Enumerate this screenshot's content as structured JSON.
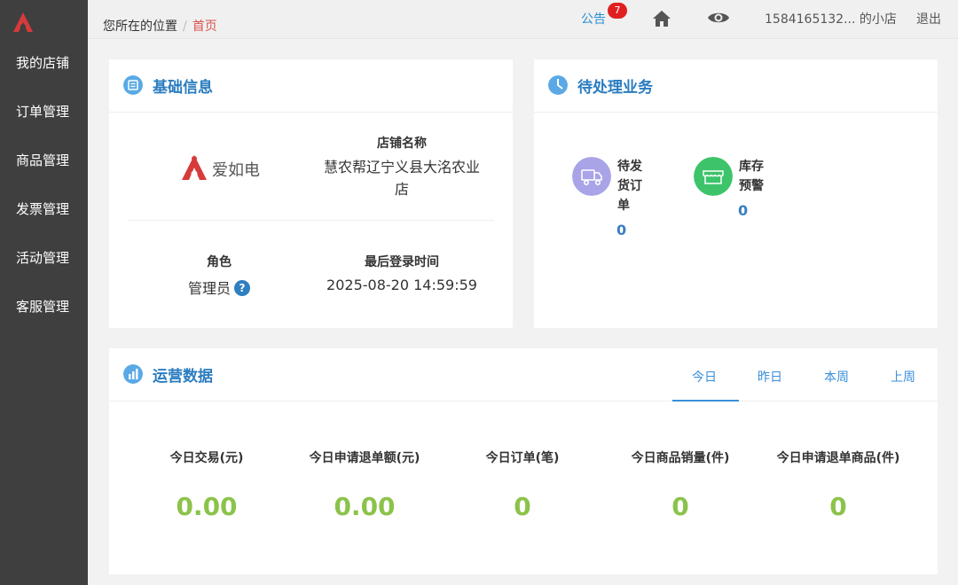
{
  "sidebar": {
    "items": [
      {
        "label": "我的店铺"
      },
      {
        "label": "订单管理"
      },
      {
        "label": "商品管理"
      },
      {
        "label": "发票管理"
      },
      {
        "label": "活动管理"
      },
      {
        "label": "客服管理"
      }
    ]
  },
  "topbar": {
    "breadcrumb_prefix": "您所在的位置",
    "breadcrumb_sep": "/",
    "breadcrumb_current": "首页",
    "announcement_label": "公告",
    "announcement_count": "7",
    "user_label": "1584165132... 的小店",
    "logout_label": "退出"
  },
  "basic_info": {
    "title": "基础信息",
    "brand_name": "爱如电",
    "store_name_label": "店铺名称",
    "store_name": "慧农帮辽宁义县大洺农业店",
    "role_label": "角色",
    "role": "管理员",
    "last_login_label": "最后登录时间",
    "last_login": "2025-08-20 14:59:59"
  },
  "pending": {
    "title": "待处理业务",
    "items": [
      {
        "label": "待发货订单",
        "count": "0",
        "icon": "truck-icon",
        "color": "#a9a3e8"
      },
      {
        "label": "库存预警",
        "count": "0",
        "icon": "store-icon",
        "color": "#3dc46a"
      }
    ]
  },
  "operations": {
    "title": "运营数据",
    "tabs": [
      {
        "label": "今日",
        "active": true
      },
      {
        "label": "昨日",
        "active": false
      },
      {
        "label": "本周",
        "active": false
      },
      {
        "label": "上周",
        "active": false
      }
    ],
    "stats": [
      {
        "label": "今日交易(元)",
        "value": "0.00"
      },
      {
        "label": "今日申请退单额(元)",
        "value": "0.00"
      },
      {
        "label": "今日订单(笔)",
        "value": "0"
      },
      {
        "label": "今日商品销量(件)",
        "value": "0"
      },
      {
        "label": "今日申请退单商品(件)",
        "value": "0"
      }
    ]
  },
  "colors": {
    "sidebar_bg": "#3f3f3f",
    "accent_blue": "#2a7cc0",
    "stat_green": "#8bc34a",
    "brand_red": "#d63a3a"
  }
}
